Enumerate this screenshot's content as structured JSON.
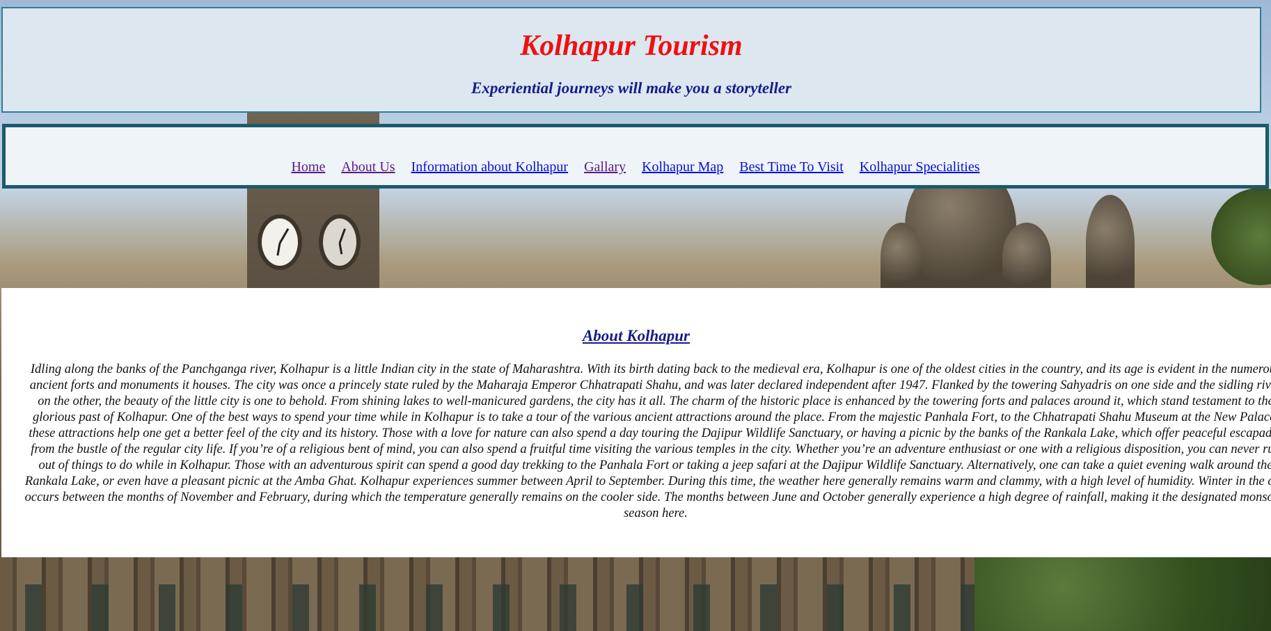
{
  "header": {
    "title": "Kolhapur Tourism",
    "tagline": "Experiential journeys will make you a storyteller"
  },
  "nav": {
    "items": [
      {
        "label": "Home",
        "state": "visited"
      },
      {
        "label": "About Us",
        "state": "visited"
      },
      {
        "label": "Information about Kolhapur",
        "state": "unvisited"
      },
      {
        "label": "Gallary",
        "state": "visited"
      },
      {
        "label": "Kolhapur Map",
        "state": "unvisited"
      },
      {
        "label": "Best Time To Visit",
        "state": "unvisited"
      },
      {
        "label": "Kolhapur Specialities",
        "state": "unvisited"
      }
    ]
  },
  "about": {
    "heading": "About Kolhapur",
    "body": "Idling along the banks of the Panchganga river, Kolhapur is a little Indian city in the state of Maharashtra. With its birth dating back to the medieval era, Kolhapur is one of the oldest cities in the country, and its age is evident in the numerous ancient forts and monuments it houses. The city was once a princely state ruled by the Maharaja Emperor Chhatrapati Shahu, and was later declared independent after 1947. Flanked by the towering Sahyadris on one side and the sidling river on the other, the beauty of the little city is one to behold. From shining lakes to well-manicured gardens, the city has it all. The charm of the historic place is enhanced by the towering forts and palaces around it, which stand testament to the glorious past of Kolhapur. One of the best ways to spend your time while in Kolhapur is to take a tour of the various ancient attractions around the place. From the majestic Panhala Fort, to the Chhatrapati Shahu Museum at the New Palace, these attractions help one get a better feel of the city and its history. Those with a love for nature can also spend a day touring the Dajipur Wildlife Sanctuary, or having a picnic by the banks of the Rankala Lake, which offer peaceful escapades from the bustle of the regular city life. If you’re of a religious bent of mind, you can also spend a fruitful time visiting the various temples in the city. Whether you’re an adventure enthusiast or one with a religious disposition, you can never run out of things to do while in Kolhapur. Those with an adventurous spirit can spend a good day trekking to the Panhala Fort or taking a jeep safari at the Dajipur Wildlife Sanctuary. Alternatively, one can take a quiet evening walk around the Rankala Lake, or even have a pleasant picnic at the Amba Ghat. Kolhapur experiences summer between April to September. During this time, the weather here generally remains warm and clammy, with a high level of humidity. Winter in the city occurs between the months of November and February, during which the temperature generally remains on the cooler side. The months between June and October generally experience a high degree of rainfall, making it the designated monsoon season here."
  },
  "colors": {
    "title": "#ee1111",
    "tagline": "#151b8a",
    "header_bg": "#dde7f0",
    "nav_border": "#1c5a6c",
    "link_visited": "#5b1a8a",
    "link_unvisited": "#0a10d6"
  }
}
